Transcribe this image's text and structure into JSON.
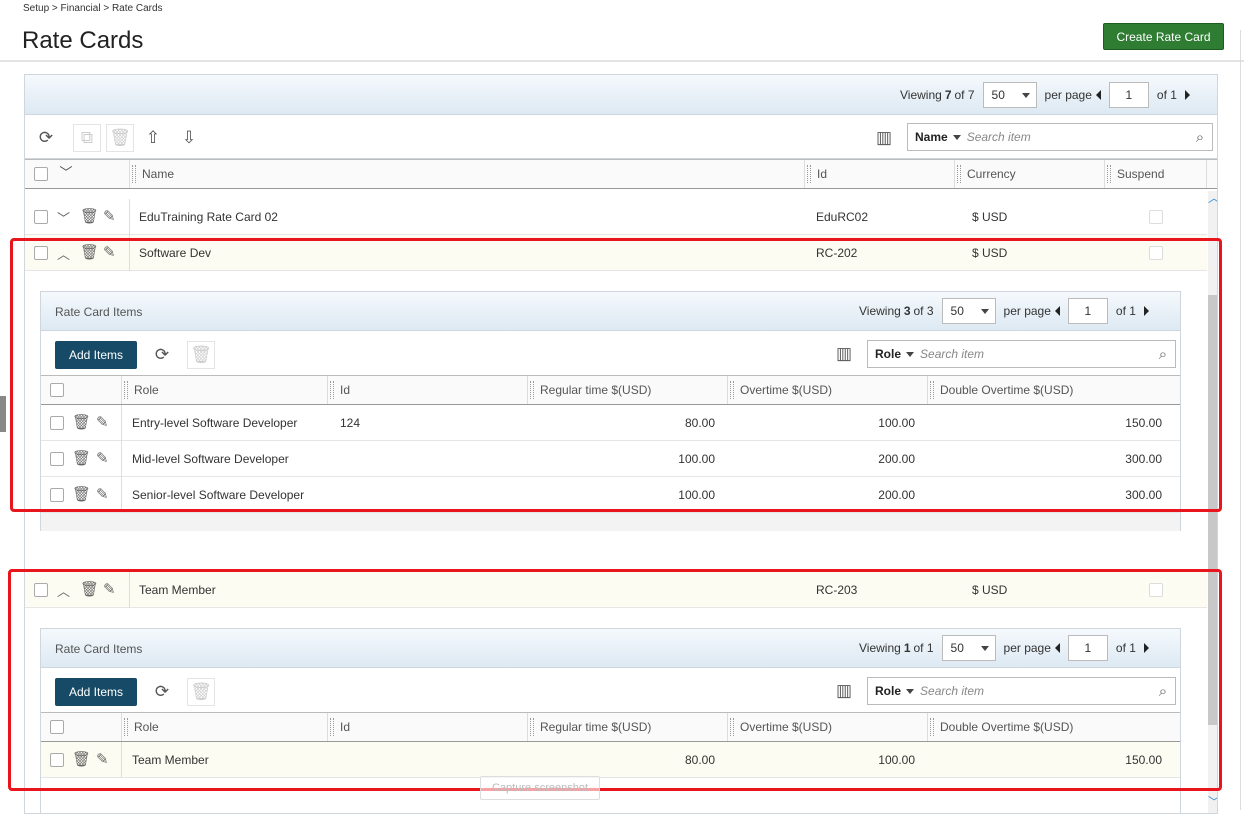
{
  "breadcrumb": "Setup > Financial > Rate Cards",
  "page_title": "Rate Cards",
  "create_button": "Create Rate Card",
  "pager": {
    "viewing_label": "Viewing",
    "viewing_count": "7",
    "of_label": "of 7",
    "per_page_value": "50",
    "per_page_label": "per page",
    "page_value": "1",
    "page_of": "of 1"
  },
  "search": {
    "field": "Name",
    "placeholder": "Search item"
  },
  "columns": {
    "name": "Name",
    "id": "Id",
    "currency": "Currency",
    "suspend": "Suspend"
  },
  "rows": [
    {
      "name": "EduTraining Rate Card 02",
      "id": "EduRC02",
      "currency": "$ USD"
    },
    {
      "name": "Software Dev",
      "id": "RC-202",
      "currency": "$ USD"
    },
    {
      "name": "Team Member",
      "id": "RC-203",
      "currency": "$ USD"
    }
  ],
  "sub1": {
    "title": "Rate Card Items",
    "viewing_label": "Viewing",
    "viewing_count": "3",
    "of_label": "of 3",
    "per_page_value": "50",
    "per_page_label": "per page",
    "page_value": "1",
    "page_of": "of 1",
    "add_label": "Add Items",
    "search_field": "Role",
    "search_placeholder": "Search item",
    "columns": {
      "role": "Role",
      "id": "Id",
      "regular": "Regular time $(USD)",
      "overtime": "Overtime $(USD)",
      "double": "Double Overtime $(USD)"
    },
    "items": [
      {
        "role": "Entry-level Software Developer",
        "id": "124",
        "regular": "80.00",
        "overtime": "100.00",
        "double": "150.00"
      },
      {
        "role": "Mid-level Software Developer",
        "id": "",
        "regular": "100.00",
        "overtime": "200.00",
        "double": "300.00"
      },
      {
        "role": "Senior-level Software Developer",
        "id": "",
        "regular": "100.00",
        "overtime": "200.00",
        "double": "300.00"
      }
    ]
  },
  "sub2": {
    "title": "Rate Card Items",
    "viewing_label": "Viewing",
    "viewing_count": "1",
    "of_label": "of 1",
    "per_page_value": "50",
    "per_page_label": "per page",
    "page_value": "1",
    "page_of": "of 1",
    "add_label": "Add Items",
    "search_field": "Role",
    "search_placeholder": "Search item",
    "columns": {
      "role": "Role",
      "id": "Id",
      "regular": "Regular time $(USD)",
      "overtime": "Overtime $(USD)",
      "double": "Double Overtime $(USD)"
    },
    "items": [
      {
        "role": "Team Member",
        "id": "",
        "regular": "80.00",
        "overtime": "100.00",
        "double": "150.00"
      }
    ]
  },
  "capture_label": "Capture screenshot",
  "colors": {
    "accent_green": "#2e7d32",
    "add_button": "#164a66",
    "highlight": "#e8161c"
  }
}
